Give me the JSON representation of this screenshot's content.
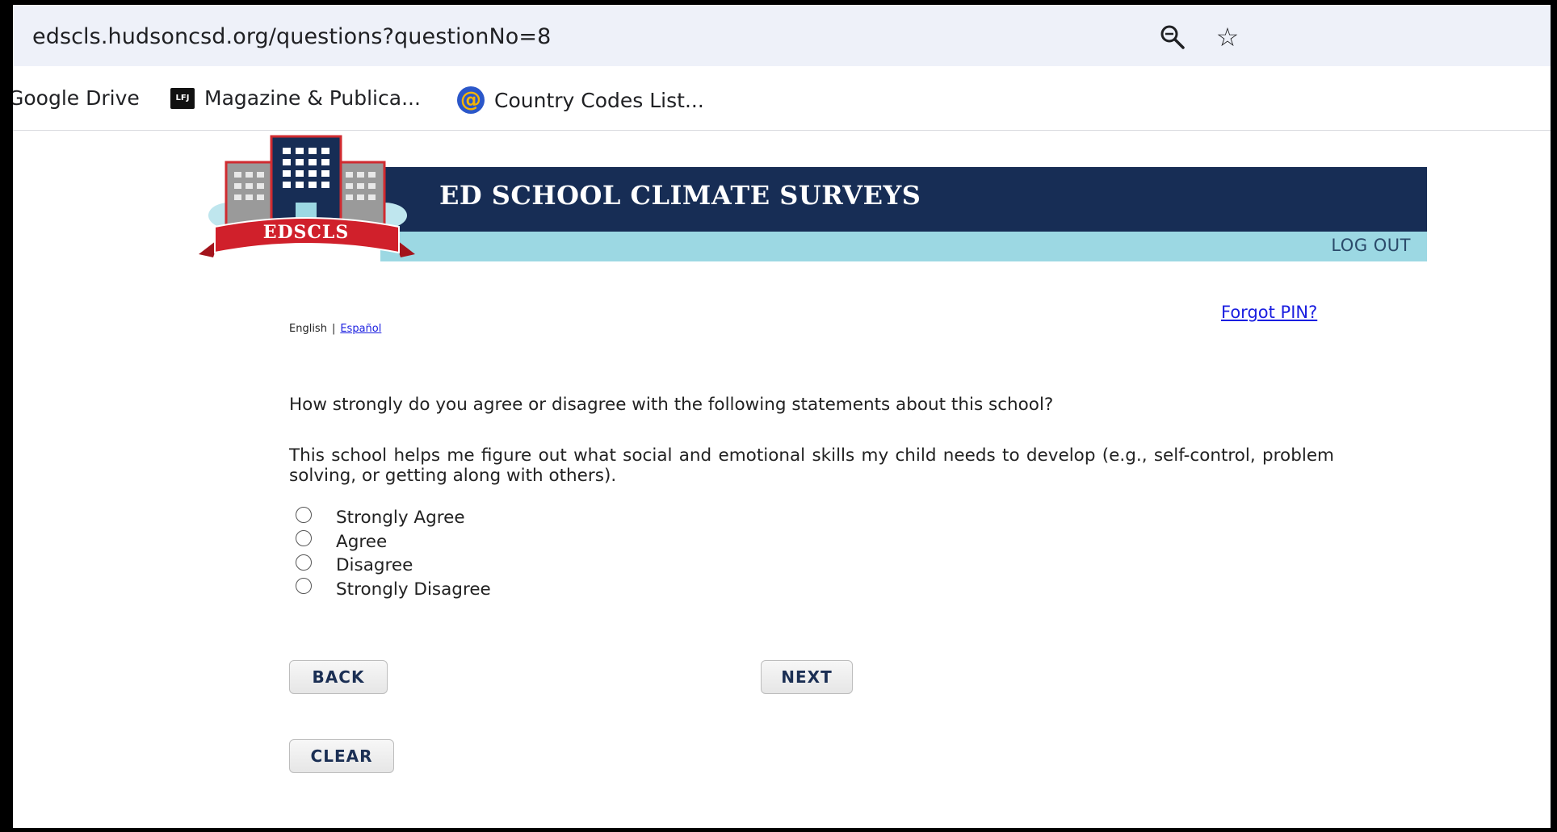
{
  "browser": {
    "url": "edscls.hudsoncsd.org/questions?questionNo=8",
    "bookmarks": [
      {
        "label": "Google Drive"
      },
      {
        "label": "Magazine & Publica...",
        "badge": "LFJ"
      },
      {
        "label": "Country Codes List...",
        "badge": "@"
      }
    ]
  },
  "header": {
    "logo_text": "EDSCLS",
    "title": "ED SCHOOL CLIMATE SURVEYS",
    "logout_label": "LOG OUT"
  },
  "language": {
    "current": "English",
    "separator": "|",
    "alternate": "Español"
  },
  "forgot_pin_label": "Forgot PIN?",
  "survey": {
    "intro": "How strongly do you agree or disagree with the following statements about this school?",
    "question": "This school helps me figure out what social and emotional skills my child needs to develop (e.g., self-control, problem solving, or getting along with others).",
    "options": [
      {
        "label": "Strongly Agree"
      },
      {
        "label": "Agree"
      },
      {
        "label": "Disagree"
      },
      {
        "label": "Strongly Disagree"
      }
    ]
  },
  "buttons": {
    "back": "BACK",
    "next": "NEXT",
    "clear": "CLEAR"
  },
  "colors": {
    "banner_dark": "#172d55",
    "banner_light": "#9cd8e3",
    "link": "#1a1ee0",
    "ribbon": "#d0202b"
  }
}
